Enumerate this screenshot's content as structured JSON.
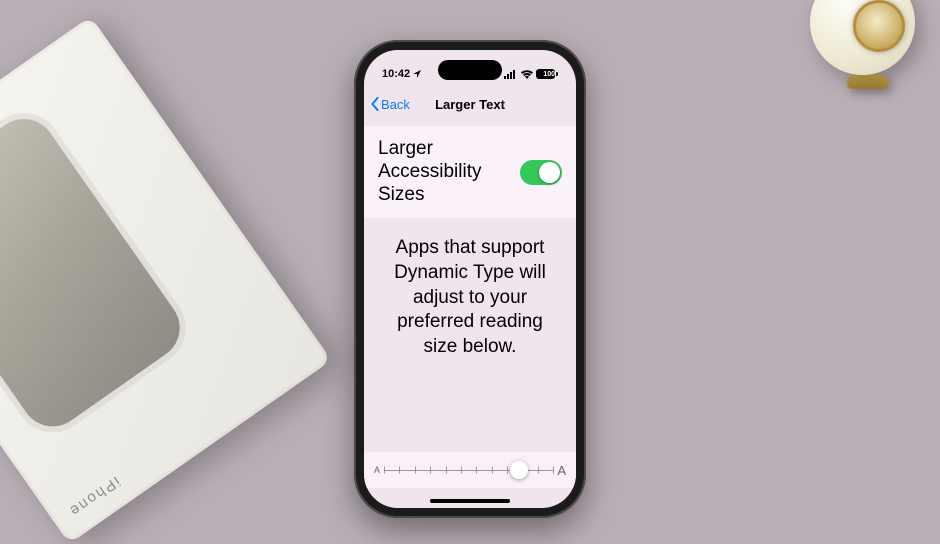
{
  "status_bar": {
    "time": "10:42",
    "battery_label": "100"
  },
  "nav": {
    "back_label": "Back",
    "title": "Larger Text"
  },
  "setting": {
    "label": "Larger Accessibility Sizes",
    "toggle_on": true
  },
  "description": "Apps that support Dynamic Type will adjust to your preferred reading size below.",
  "slider": {
    "min_label": "A",
    "max_label": "A",
    "ticks": 12,
    "position_pct": 80
  }
}
